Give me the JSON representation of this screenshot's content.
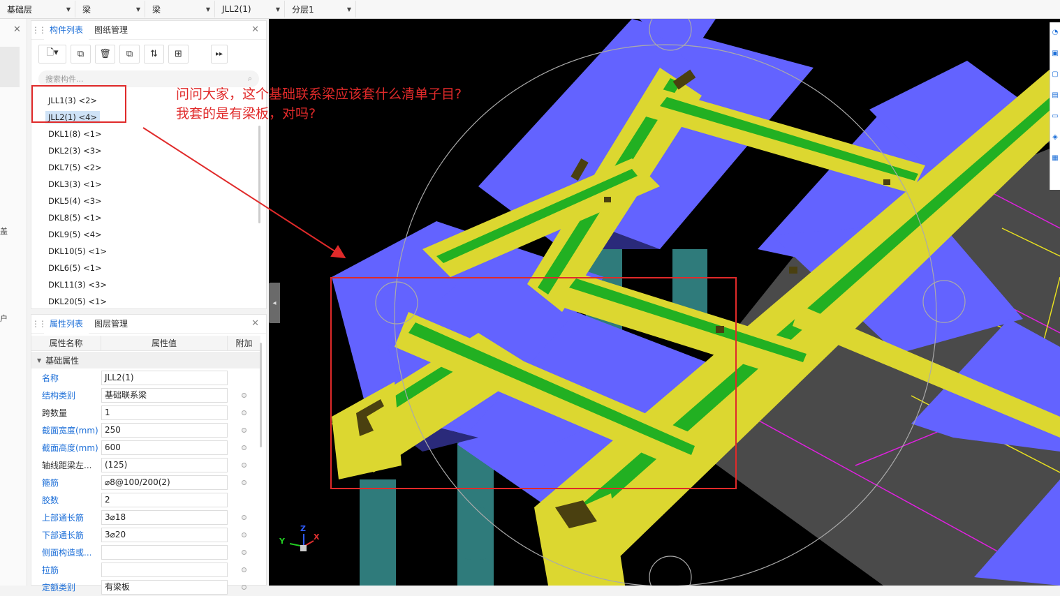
{
  "topbar": {
    "floor": "基础层",
    "category": "梁",
    "subcategory": "梁",
    "component": "JLL2(1)",
    "layer": "分层1"
  },
  "left_strip": {
    "glyph1": "盖",
    "glyph2": "户"
  },
  "component_panel": {
    "tab_active": "构件列表",
    "tab_other": "图纸管理",
    "search_placeholder": "搜索构件...",
    "items": [
      "JLL1(3) <2>",
      "JLL2(1) <4>",
      "DKL1(8) <1>",
      "DKL2(3) <3>",
      "DKL7(5) <2>",
      "DKL3(3) <1>",
      "DKL5(4) <3>",
      "DKL8(5) <1>",
      "DKL9(5) <4>",
      "DKL10(5) <1>",
      "DKL6(5) <1>",
      "DKL11(3) <3>",
      "DKL20(5) <1>"
    ],
    "selected_index": 1
  },
  "property_panel": {
    "tab_active": "属性列表",
    "tab_other": "图层管理",
    "col_name": "属性名称",
    "col_value": "属性值",
    "col_extra": "附加",
    "group": "基础属性",
    "rows": [
      {
        "name": "名称",
        "value": "JLL2(1)",
        "blue": true,
        "extra": false
      },
      {
        "name": "结构类别",
        "value": "基础联系梁",
        "blue": true,
        "extra": true
      },
      {
        "name": "跨数量",
        "value": "1",
        "blue": false,
        "extra": true
      },
      {
        "name": "截面宽度(mm)",
        "value": "250",
        "blue": true,
        "extra": true
      },
      {
        "name": "截面高度(mm)",
        "value": "600",
        "blue": true,
        "extra": true
      },
      {
        "name": "轴线距梁左...",
        "value": "(125)",
        "blue": false,
        "extra": true
      },
      {
        "name": "箍筋",
        "value": "⌀8@100/200(2)",
        "blue": true,
        "extra": true
      },
      {
        "name": "胶数",
        "value": "2",
        "blue": true,
        "extra": false
      },
      {
        "name": "上部通长筋",
        "value": "3⌀18",
        "blue": true,
        "extra": true
      },
      {
        "name": "下部通长筋",
        "value": "3⌀20",
        "blue": true,
        "extra": true
      },
      {
        "name": "侧面构造或...",
        "value": "",
        "blue": true,
        "extra": true
      },
      {
        "name": "拉筋",
        "value": "",
        "blue": true,
        "extra": true
      },
      {
        "name": "定额类别",
        "value": "有梁板",
        "blue": true,
        "extra": true
      }
    ]
  },
  "annotation": {
    "line1": "问问大家，这个基础联系梁应该套什么清单子目?",
    "line2": "我套的是有梁板，对吗?"
  },
  "axes": {
    "x": "X",
    "y": "Y",
    "z": "Z"
  },
  "colors": {
    "accent": "#1d6fd8",
    "annotation": "#e02a2a",
    "cap": "#6363ff",
    "beam": "#dcd730",
    "rebar": "#22b022",
    "column": "#2f7b7b",
    "slab": "#4a4a4a"
  }
}
